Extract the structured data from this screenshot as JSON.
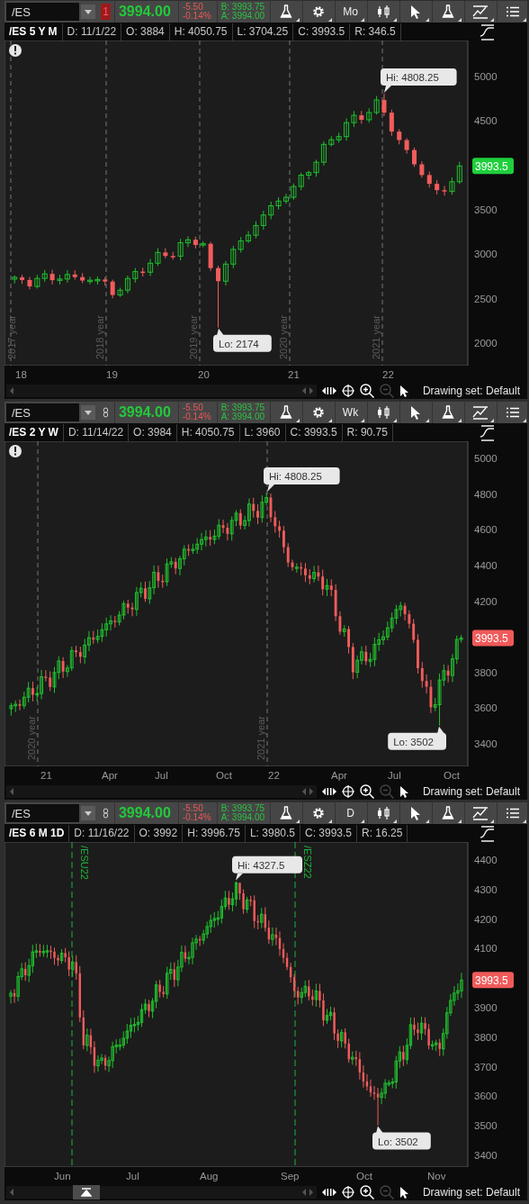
{
  "panels": [
    {
      "symbol": "/ES",
      "link": {
        "kind": "number",
        "label": "1"
      },
      "last": "3994.00",
      "change": "-5.50",
      "change_pct": "-0.14%",
      "bid": "B: 3993.75",
      "ask": "A: 3994.00",
      "aggregation": "Mo",
      "title": "/ES 5 Y M",
      "stats": [
        "D: 11/1/22",
        "O: 3884",
        "H: 4050.75",
        "L: 3704.25",
        "C: 3993.5",
        "R: 346.5"
      ],
      "alert": true,
      "markers": [
        {
          "kind": "year",
          "label": "2017 year"
        },
        {
          "kind": "year",
          "label": "2018 year"
        },
        {
          "kind": "year",
          "label": "2019 year"
        },
        {
          "kind": "year",
          "label": "2020 year"
        },
        {
          "kind": "year",
          "label": "2021 year"
        }
      ],
      "hi": "Hi: 4808.25",
      "lo": "Lo: 2174",
      "price_labels": [
        "5000",
        "4500",
        "3500",
        "3000",
        "2500",
        "2000"
      ],
      "current": {
        "label": "3993.5",
        "color": "#1fcf3c"
      },
      "time_labels": [
        "18",
        "19",
        "20",
        "21",
        "22"
      ],
      "scroll_up_button": false,
      "drawing_set": "Drawing set: Default"
    },
    {
      "symbol": "/ES",
      "link": {
        "kind": "chain"
      },
      "last": "3994.00",
      "change": "-5.50",
      "change_pct": "-0.14%",
      "bid": "B: 3993.75",
      "ask": "A: 3994.00",
      "aggregation": "Wk",
      "title": "/ES 2 Y W",
      "stats": [
        "D: 11/14/22",
        "O: 3984",
        "H: 4050.75",
        "L: 3960",
        "C: 3993.5",
        "R: 90.75"
      ],
      "alert": true,
      "markers": [
        {
          "kind": "year",
          "label": "2020 year"
        },
        {
          "kind": "year",
          "label": "2021 year"
        }
      ],
      "hi": "Hi: 4808.25",
      "lo": "Lo: 3502",
      "price_labels": [
        "5000",
        "4800",
        "4600",
        "4400",
        "4200",
        "3800",
        "3600",
        "3400"
      ],
      "current": {
        "label": "3993.5",
        "color": "#f05a5a"
      },
      "time_labels": [
        "21",
        "Apr",
        "Jul",
        "Oct",
        "22",
        "Apr",
        "Jul",
        "Oct"
      ],
      "scroll_up_button": false,
      "drawing_set": "Drawing set: Default"
    },
    {
      "symbol": "/ES",
      "link": {
        "kind": "chain"
      },
      "last": "3994.00",
      "change": "-5.50",
      "change_pct": "-0.14%",
      "bid": "B: 3993.75",
      "ask": "A: 3994.00",
      "aggregation": "D",
      "title": "/ES 6 M 1D",
      "stats": [
        "D: 11/16/22",
        "O: 3992",
        "H: 3996.75",
        "L: 3980.5",
        "C: 3993.5",
        "R: 16.25"
      ],
      "alert": false,
      "markers": [
        {
          "kind": "contract",
          "label": "/ESU22"
        },
        {
          "kind": "contract",
          "label": "/ESZ22"
        }
      ],
      "hi": "Hi: 4327.5",
      "lo": "Lo: 3502",
      "price_labels": [
        "4400",
        "4300",
        "4200",
        "4100",
        "3900",
        "3800",
        "3700",
        "3600",
        "3500",
        "3400"
      ],
      "current": {
        "label": "3993.5",
        "color": "#f05a5a"
      },
      "time_labels": [
        "Jun",
        "Jul",
        "Aug",
        "Sep",
        "Oct",
        "Nov"
      ],
      "scroll_up_button": true,
      "drawing_set": "Drawing set: Default"
    }
  ]
}
